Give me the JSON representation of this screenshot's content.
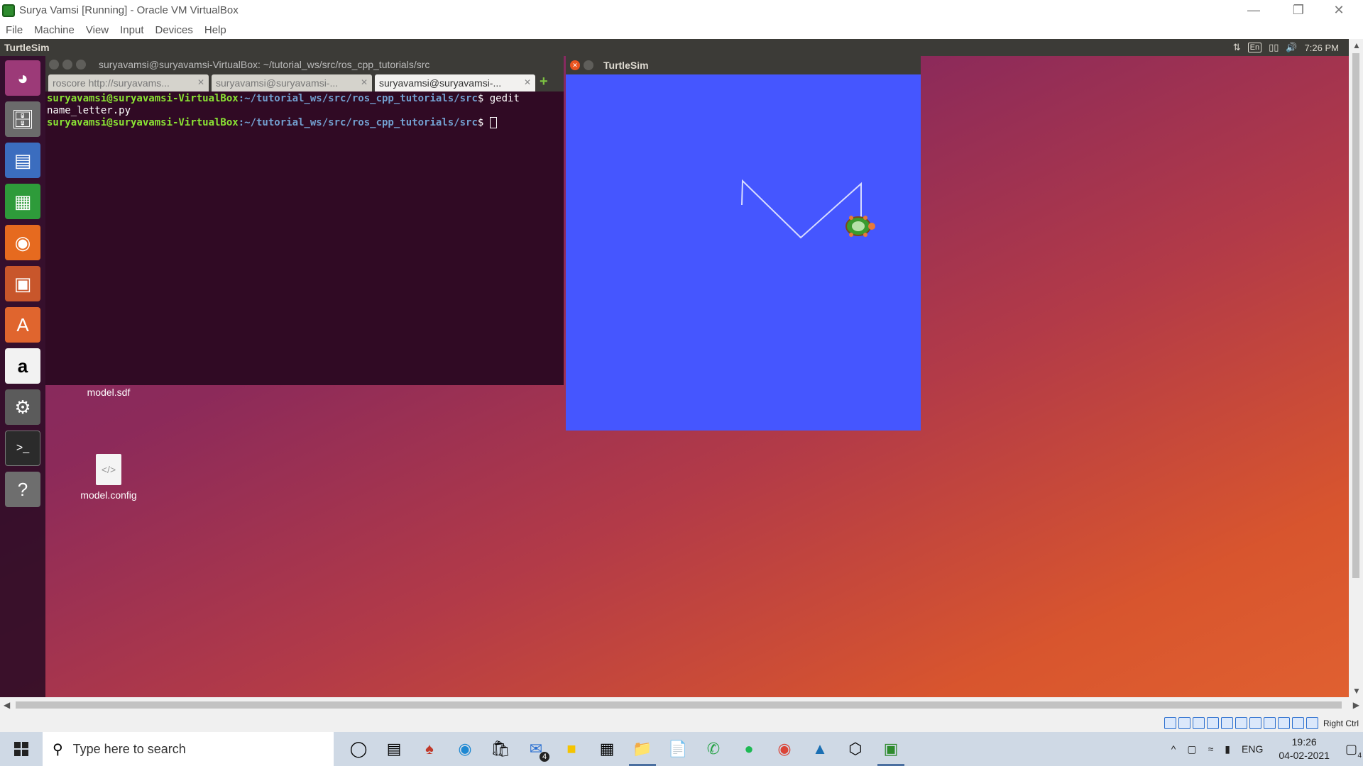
{
  "vbox": {
    "title": "Surya Vamsi [Running] - Oracle VM VirtualBox",
    "menu": [
      "File",
      "Machine",
      "View",
      "Input",
      "Devices",
      "Help"
    ],
    "status_right": "Right Ctrl"
  },
  "ubuntu": {
    "panel_title": "TurtleSim",
    "keyboard_indicator": "En",
    "time": "7:26 PM"
  },
  "launcher": {
    "items": [
      "ubuntu-dash",
      "files",
      "libreoffice-writer",
      "libreoffice-calc",
      "firefox",
      "libreoffice-impress",
      "software-center",
      "amazon",
      "system-settings",
      "terminal",
      "help"
    ]
  },
  "terminal": {
    "title": "suryavamsi@suryavamsi-VirtualBox: ~/tutorial_ws/src/ros_cpp_tutorials/src",
    "tabs": [
      "roscore http://suryavams...",
      "suryavamsi@suryavamsi-...",
      "suryavamsi@suryavamsi-..."
    ],
    "line1_user": "suryavamsi@suryavamsi-VirtualBox",
    "line1_path": ":~/tutorial_ws/src/ros_cpp_tutorials/src",
    "line1_cmd": "$ gedit",
    "line2": "name_letter.py",
    "line3_user": "suryavamsi@suryavamsi-VirtualBox",
    "line3_path": ":~/tutorial_ws/src/ros_cpp_tutorials/src",
    "line3_cmd": "$ "
  },
  "desktop": {
    "files": [
      {
        "name": "model.sdf"
      },
      {
        "name": "model.config"
      }
    ]
  },
  "turtlesim": {
    "title": "TurtleSim",
    "background": "#4556ff",
    "path_color": "#d8dcff",
    "drawn_letter": "M"
  },
  "taskbar": {
    "search_placeholder": "Type here to search",
    "mail_badge": "4",
    "language": "ENG",
    "time": "19:26",
    "date": "04-02-2021",
    "notification_count": "4"
  }
}
